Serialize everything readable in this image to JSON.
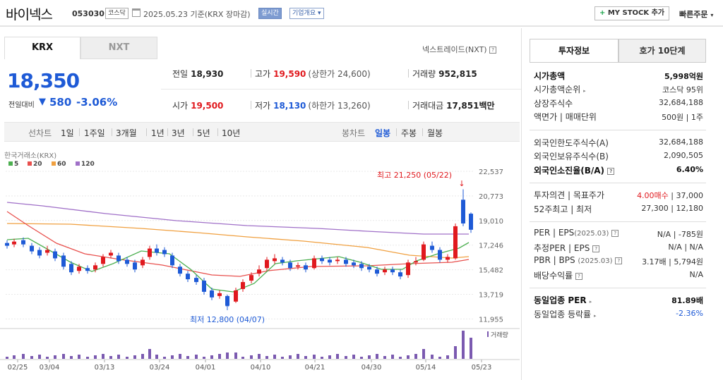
{
  "header": {
    "name": "바이넥스",
    "code": "053030",
    "market_badge": "코스닥",
    "date": "2025.05.23 기준(KRX 장마감)",
    "live_badge": "실시간",
    "info_badge": "기업개요",
    "mystock": "MY STOCK 추가",
    "quick_order": "빠른주문"
  },
  "tabs": {
    "krx": "KRX",
    "nxt": "NXT"
  },
  "nextrade": "넥스트레이드(NXT)",
  "price": {
    "current": "18,350",
    "change_label": "전일대비",
    "change": "580",
    "change_pct": "-3.06%"
  },
  "quote": {
    "prev_label": "전일",
    "prev": "18,930",
    "high_label": "고가",
    "high": "19,590",
    "upper_limit": "(상한가 24,600)",
    "volume_label": "거래량",
    "volume": "952,815",
    "open_label": "시가",
    "open": "19,500",
    "low_label": "저가",
    "low": "18,130",
    "lower_limit": "(하한가 13,260)",
    "amount_label": "거래대금",
    "amount": "17,851",
    "amount_unit": "백만"
  },
  "period": {
    "line_label": "선차트",
    "line_items": [
      "1일",
      "1주일",
      "3개월",
      "1년",
      "3년",
      "5년",
      "10년"
    ],
    "candle_label": "봉차트",
    "candle_items": [
      "일봉",
      "주봉",
      "월봉"
    ],
    "candle_selected": "일봉"
  },
  "chart_data": {
    "type": "candlestick",
    "source_label": "한국거래소(KRX)",
    "legend": [
      {
        "name": "5",
        "color": "#4caf50"
      },
      {
        "name": "20",
        "color": "#e8504d"
      },
      {
        "name": "60",
        "color": "#f0a040"
      },
      {
        "name": "120",
        "color": "#a070c8"
      }
    ],
    "y_ticks": [
      "22,537",
      "20,773",
      "19,010",
      "17,246",
      "15,482",
      "13,719",
      "11,955"
    ],
    "ylim": [
      11955,
      22537
    ],
    "x_ticks": [
      "02/25",
      "03/04",
      "03/13",
      "03/24",
      "04/01",
      "04/10",
      "04/21",
      "04/30",
      "05/14",
      "05/23"
    ],
    "max_annotation": "최고 21,250 (05/22)",
    "min_annotation": "최저 12,800 (04/07)",
    "volume_label": "거래량",
    "up_color": "#e0191e",
    "down_color": "#1e5ad6"
  },
  "invest": {
    "tab1": "투자정보",
    "tab2": "호가 10단계",
    "rows1": [
      {
        "k": "시가총액",
        "v": "5,998억원",
        "bold": true
      },
      {
        "k": "시가총액순위",
        "v": "코스닥 95위",
        "arrow": true
      },
      {
        "k": "상장주식수",
        "v": "32,684,188"
      },
      {
        "k": "액면가 | 매매단위",
        "v": "500원 | 1주"
      }
    ],
    "rows2": [
      {
        "k": "외국인한도주식수(A)",
        "v": "32,684,188"
      },
      {
        "k": "외국인보유주식수(B)",
        "v": "2,090,505"
      },
      {
        "k": "외국인소진율(B/A)",
        "v": "6.40%",
        "bold": true,
        "help": true
      }
    ],
    "rows3": [
      {
        "k": "투자의견 | 목표주가",
        "v_red": "4.00매수",
        "v": " | 37,000"
      },
      {
        "k": "52주최고 | 최저",
        "v": "27,300 | 12,180"
      }
    ],
    "rows4": [
      {
        "k": "PER | EPS",
        "ksub": "(2025.03)",
        "v": "N/A | -785원"
      },
      {
        "k": "추정PER | EPS",
        "v": "N/A | N/A"
      },
      {
        "k": "PBR | BPS",
        "ksub": "(2025.03)",
        "v": "3.17배 | 5,794원"
      },
      {
        "k": "배당수익률",
        "v": "N/A"
      }
    ],
    "rows5": [
      {
        "k": "동일업종 PER",
        "v": "81.89배",
        "bold": true
      },
      {
        "k": "동일업종 등락률",
        "v": "-2.36%",
        "blue": true
      }
    ]
  }
}
